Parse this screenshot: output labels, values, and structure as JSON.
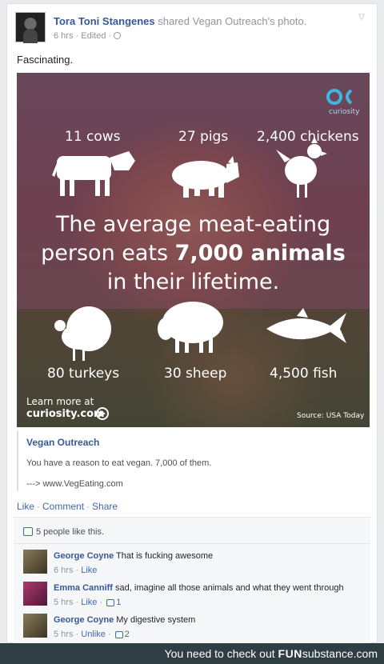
{
  "post": {
    "author": "Tora Toni Stangenes",
    "shared_text": " shared Vegan Outreach's photo.",
    "time": "6 hrs",
    "edited": "Edited",
    "status": "Fascinating."
  },
  "image": {
    "counts": {
      "cows": "11 cows",
      "pigs": "27 pigs",
      "chickens": "2,400 chickens",
      "turkeys": "80 turkeys",
      "sheep": "30 sheep",
      "fish": "4,500 fish"
    },
    "headline_1": "The average meat-eating",
    "headline_2a": "person eats ",
    "headline_2b": "7,000 animals",
    "headline_3": "in their lifetime.",
    "logo_text": "curiosity",
    "learn_more_1": "Learn more at",
    "learn_more_2": "curiosity.com",
    "source": "Source: USA Today"
  },
  "attachment": {
    "title": "Vegan Outreach",
    "description": "You have a reason to eat vegan. 7,000 of them.",
    "link": "---> www.VegEating.com"
  },
  "actions": {
    "like": "Like",
    "comment": "Comment",
    "share": "Share"
  },
  "likes_summary": "5 people like this.",
  "comments": [
    {
      "name": "George Coyne",
      "text": "That is fucking awesome",
      "time": "6 hrs",
      "action": "Like",
      "likes": ""
    },
    {
      "name": "Emma Canniff",
      "text": "sad, imagine all those animals and what they went through",
      "time": "5 hrs",
      "action": "Like",
      "likes": "1"
    },
    {
      "name": "George Coyne",
      "text": "My digestive system",
      "time": "5 hrs",
      "action": "Unlike",
      "likes": "2"
    }
  ],
  "footer": {
    "text": "You need to check out ",
    "brand_a": "FUN",
    "brand_b": "substance",
    "brand_c": ".com"
  },
  "colors": {
    "link_blue": "#365899",
    "logo_teal": "#3fb6e0",
    "footer_bg": "#2e3e43"
  }
}
